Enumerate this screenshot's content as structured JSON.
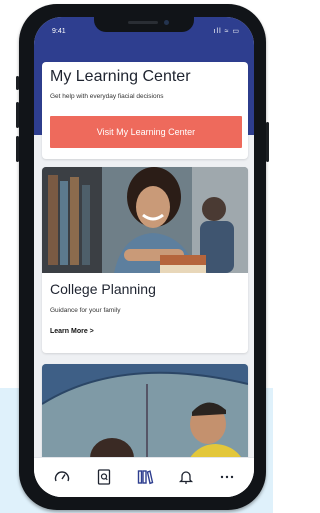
{
  "status_bar": {
    "time": "9:41",
    "icons_text": "ıll ≈ ▭"
  },
  "learning_center": {
    "title": "My Learning Center",
    "subtitle": "Get help with everyday fiacial decisions",
    "cta_label": "Visit My Learning Center"
  },
  "college_card": {
    "title": "College Planning",
    "subtitle": "Guidance for your family",
    "link_label": "Learn More >"
  },
  "tab_bar": {
    "items": [
      {
        "icon": "gauge-icon"
      },
      {
        "icon": "document-search-icon"
      },
      {
        "icon": "library-books-icon",
        "active": true
      },
      {
        "icon": "bell-icon"
      },
      {
        "icon": "more-icon"
      }
    ]
  },
  "colors": {
    "header_blue": "#2e3e8f",
    "cta_coral": "#ee6a5c",
    "active_tab": "#2e3e8f",
    "backdrop": "#dff1fb"
  }
}
